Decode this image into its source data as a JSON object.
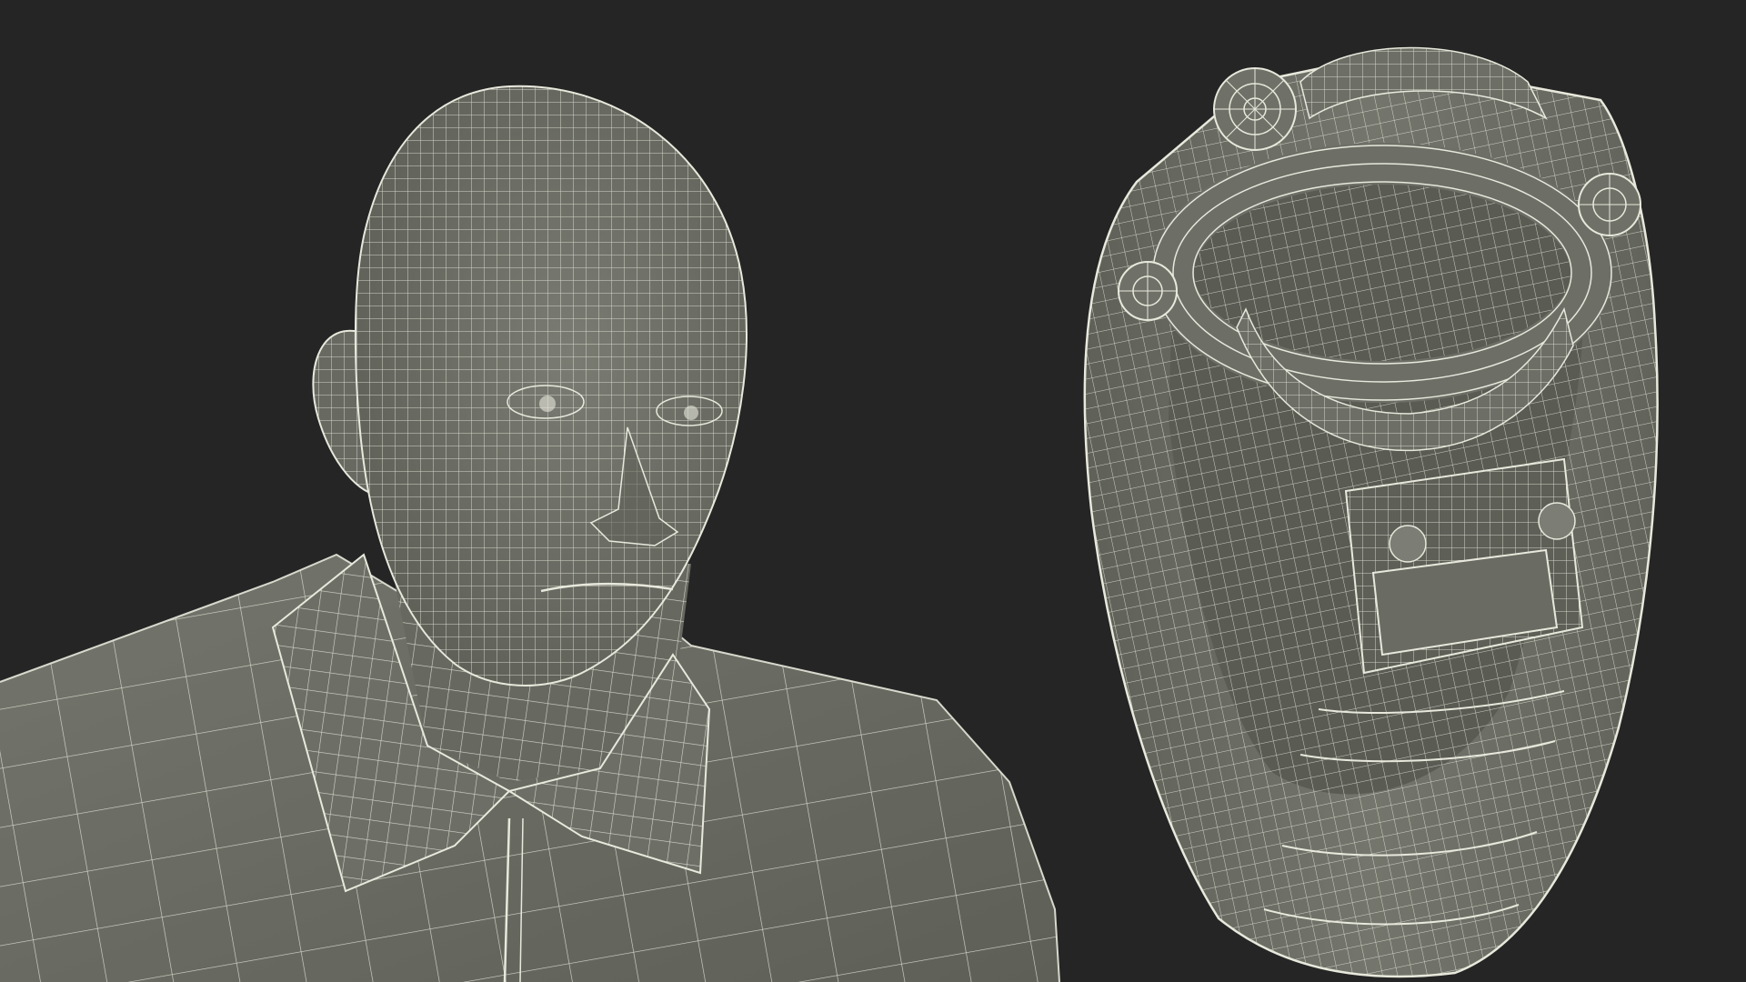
{
  "scene": {
    "background_color": "#252525",
    "model_surface_color": "#6f7168",
    "model_shadow_color": "#55574f",
    "wireframe_color": "#e8e8dc",
    "render_style": "wireframe-over-shaded"
  },
  "panels": [
    {
      "name": "worker-head-and-shirt",
      "subject": "human-head-with-collared-shirt"
    },
    {
      "name": "welding-helmet",
      "subject": "welding-helmet-interior-view"
    }
  ]
}
